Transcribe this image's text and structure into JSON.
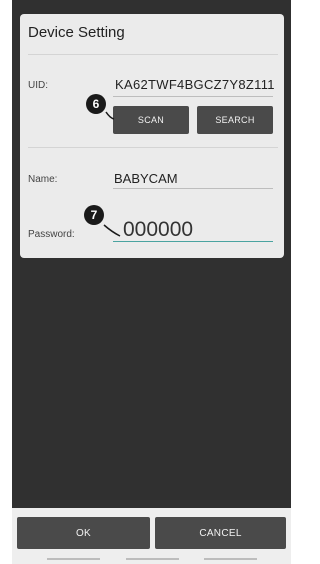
{
  "dialog": {
    "title": "Device Setting",
    "uid_label": "UID:",
    "uid_value": "KA62TWF4BGCZ7Y8Z111",
    "scan_label": "SCAN",
    "search_label": "SEARCH",
    "name_label": "Name:",
    "name_value": "BABYCAM",
    "password_label": "Password:",
    "password_value": "000000"
  },
  "callouts": {
    "six": "6",
    "seven": "7"
  },
  "footer": {
    "ok_label": "OK",
    "cancel_label": "CANCEL"
  },
  "colors": {
    "screen": "#303030",
    "dialog": "#ebebeb",
    "button": "#4a4a4a",
    "accent": "#4aa3a0"
  }
}
